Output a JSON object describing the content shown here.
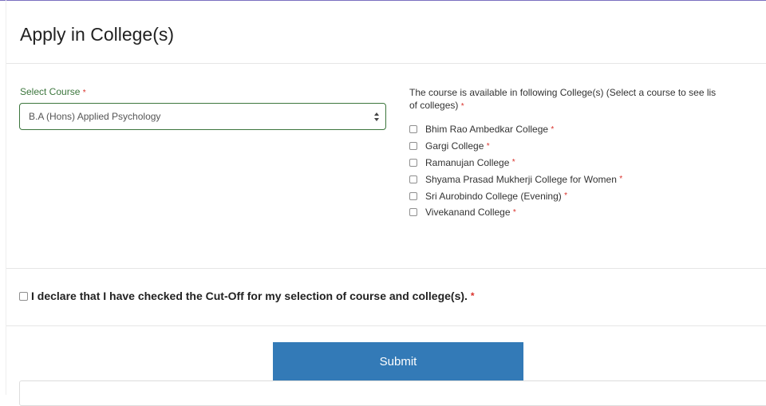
{
  "page": {
    "title": "Apply in College(s)"
  },
  "course": {
    "label": "Select Course",
    "required_mark": "*",
    "selected_value": "B.A (Hons) Applied Psychology"
  },
  "colleges": {
    "intro_line1": "The course is available in following College(s) (Select a course to see lis",
    "intro_line2": "of colleges)",
    "required_mark": "*",
    "items": [
      {
        "name": "Bhim Rao Ambedkar College",
        "required_mark": "*",
        "checked": false
      },
      {
        "name": "Gargi College",
        "required_mark": "*",
        "checked": false
      },
      {
        "name": "Ramanujan College",
        "required_mark": "*",
        "checked": false
      },
      {
        "name": "Shyama Prasad Mukherji College for Women",
        "required_mark": "*",
        "checked": false
      },
      {
        "name": "Sri Aurobindo College (Evening)",
        "required_mark": "*",
        "checked": false
      },
      {
        "name": "Vivekanand College",
        "required_mark": "*",
        "checked": false
      }
    ]
  },
  "declaration": {
    "text": "I declare that I have checked the Cut-Off for my selection of course and college(s).",
    "required_mark": "*",
    "checked": false
  },
  "actions": {
    "submit_label": "Submit"
  },
  "colors": {
    "label_green": "#3c763d",
    "required_red": "#d9312b",
    "submit_blue": "#337ab7"
  }
}
